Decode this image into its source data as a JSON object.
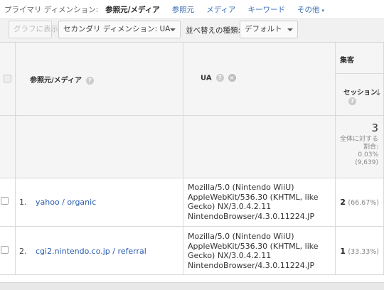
{
  "primary_dimension": {
    "label": "プライマリ ディメンション:",
    "active": "参照元/メディア",
    "links": [
      "参照元",
      "メディア",
      "キーワード",
      "その他"
    ],
    "more_caret": "▾"
  },
  "toolbar": {
    "plot_rows": "グラフに表示",
    "secondary_dimension": "セカンダリ ディメンション: UA",
    "sort_label": "並べ替えの種類:",
    "sort_value": "デフォルト"
  },
  "table": {
    "col_source": "参照元/メディア",
    "col_ua": "UA",
    "group_acquisition": "集客",
    "col_sessions": "セッション",
    "totals": {
      "sessions": "3",
      "pct_label": "全体に対する割合:",
      "pct_value": "0.03%",
      "pct_total": "(9,639)"
    },
    "rows": [
      {
        "num": "1.",
        "source": "yahoo / organic",
        "ua": "Mozilla/5.0 (Nintendo WiiU) AppleWebKit/536.30 (KHTML, like Gecko) NX/3.0.4.2.11 NintendoBrowser/4.3.0.11224.JP",
        "sessions": "2",
        "sessions_pct": "(66.67%)"
      },
      {
        "num": "2.",
        "source": "cgi2.nintendo.co.jp / referral",
        "ua": "Mozilla/5.0 (Nintendo WiiU) AppleWebKit/536.30 (KHTML, like Gecko) NX/3.0.4.2.11 NintendoBrowser/4.3.0.11224.JP",
        "sessions": "1",
        "sessions_pct": "(33.33%)"
      }
    ]
  },
  "icons": {
    "help": "?",
    "remove": "×",
    "sort_desc": "↓"
  },
  "colors": {
    "link": "#3a6eb7",
    "header_bg": "#f5f5f5",
    "border": "#d9d9d9"
  }
}
